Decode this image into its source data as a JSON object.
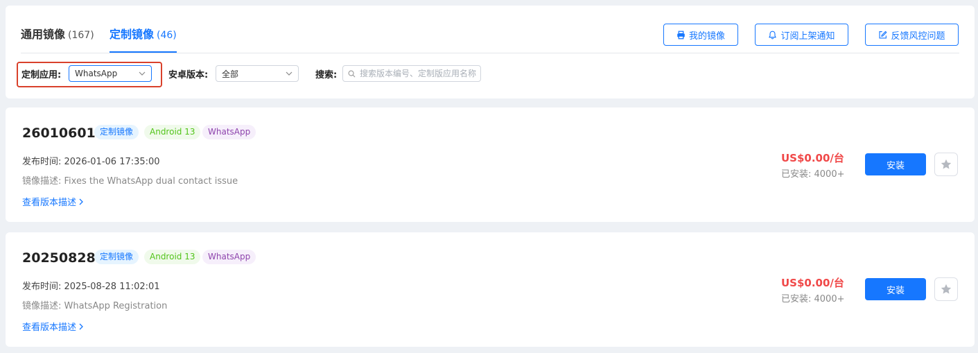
{
  "tabs": {
    "general_label": "通用镜像",
    "general_count": "(167)",
    "custom_label": "定制镜像",
    "custom_count": "(46)",
    "active": "custom"
  },
  "header_buttons": {
    "my_images": "我的镜像",
    "subscribe": "订阅上架通知",
    "feedback": "反馈风控问题"
  },
  "filters": {
    "app_label": "定制应用:",
    "app_value": "WhatsApp",
    "version_label": "安卓版本:",
    "version_value": "全部",
    "search_label": "搜索:",
    "search_placeholder": "搜索版本编号、定制版应用名称"
  },
  "images": [
    {
      "version": "26010601",
      "tags": [
        "定制镜像",
        "Android 13",
        "WhatsApp"
      ],
      "release_time": "发布时间: 2026-01-06 17:35:00",
      "description": "镜像描述: Fixes the WhatsApp dual contact issue",
      "view_link": "查看版本描述",
      "price": "US$0.00/台",
      "installed": "已安装: 4000+",
      "install_label": "安装"
    },
    {
      "version": "20250828",
      "tags": [
        "定制镜像",
        "Android 13",
        "WhatsApp"
      ],
      "release_time": "发布时间: 2025-08-28 11:02:01",
      "description": "镜像描述: WhatsApp Registration",
      "view_link": "查看版本描述",
      "price": "US$0.00/台",
      "installed": "已安装: 4000+",
      "install_label": "安装"
    }
  ],
  "colors": {
    "accent": "#1677ff",
    "price": "#f04848",
    "highlight_border": "#d9412b",
    "page_background": "#eef1f5"
  },
  "icons": {
    "my_images": "printer-icon",
    "subscribe": "bell-icon",
    "feedback": "edit-icon",
    "select_arrow": "chevron-down-icon",
    "search": "search-icon",
    "link_arrow": "chevron-right-icon",
    "favorite": "star-icon"
  }
}
